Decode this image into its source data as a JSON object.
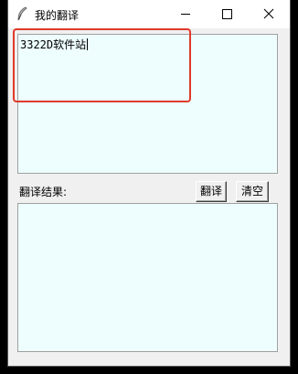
{
  "window": {
    "title": "我的翻译",
    "icon": "feather-icon",
    "controls": [
      "minimize-icon",
      "maximize-icon",
      "close-icon"
    ]
  },
  "input": {
    "value": "3322D软件站"
  },
  "result": {
    "label": "翻译结果:",
    "value": ""
  },
  "buttons": {
    "translate_label": "翻译",
    "clear_label": "清空"
  },
  "colors": {
    "text_area_bg": "#eefefe",
    "highlight": "#e03a2b"
  }
}
